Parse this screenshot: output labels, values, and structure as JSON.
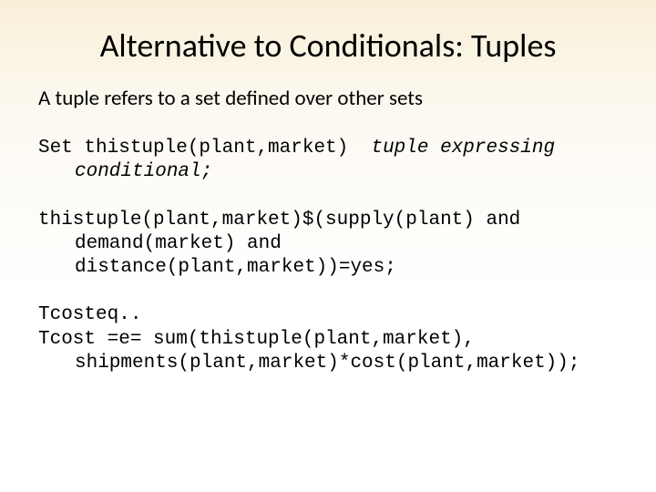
{
  "title": "Alternative to Conditionals: Tuples",
  "subtitle": "A tuple refers to a set defined over other sets",
  "block1": {
    "line1a": "Set thistuple(plant,market)  ",
    "line1b": "tuple expressing",
    "line2": "conditional;"
  },
  "block2": {
    "line1": "thistuple(plant,market)$(supply(plant) and",
    "line2": "demand(market) and",
    "line3": "distance(plant,market))=yes;"
  },
  "block3": {
    "line1": "Tcosteq..",
    "line2": "Tcost =e= sum(thistuple(plant,market),",
    "line3": "shipments(plant,market)*cost(plant,market));"
  }
}
